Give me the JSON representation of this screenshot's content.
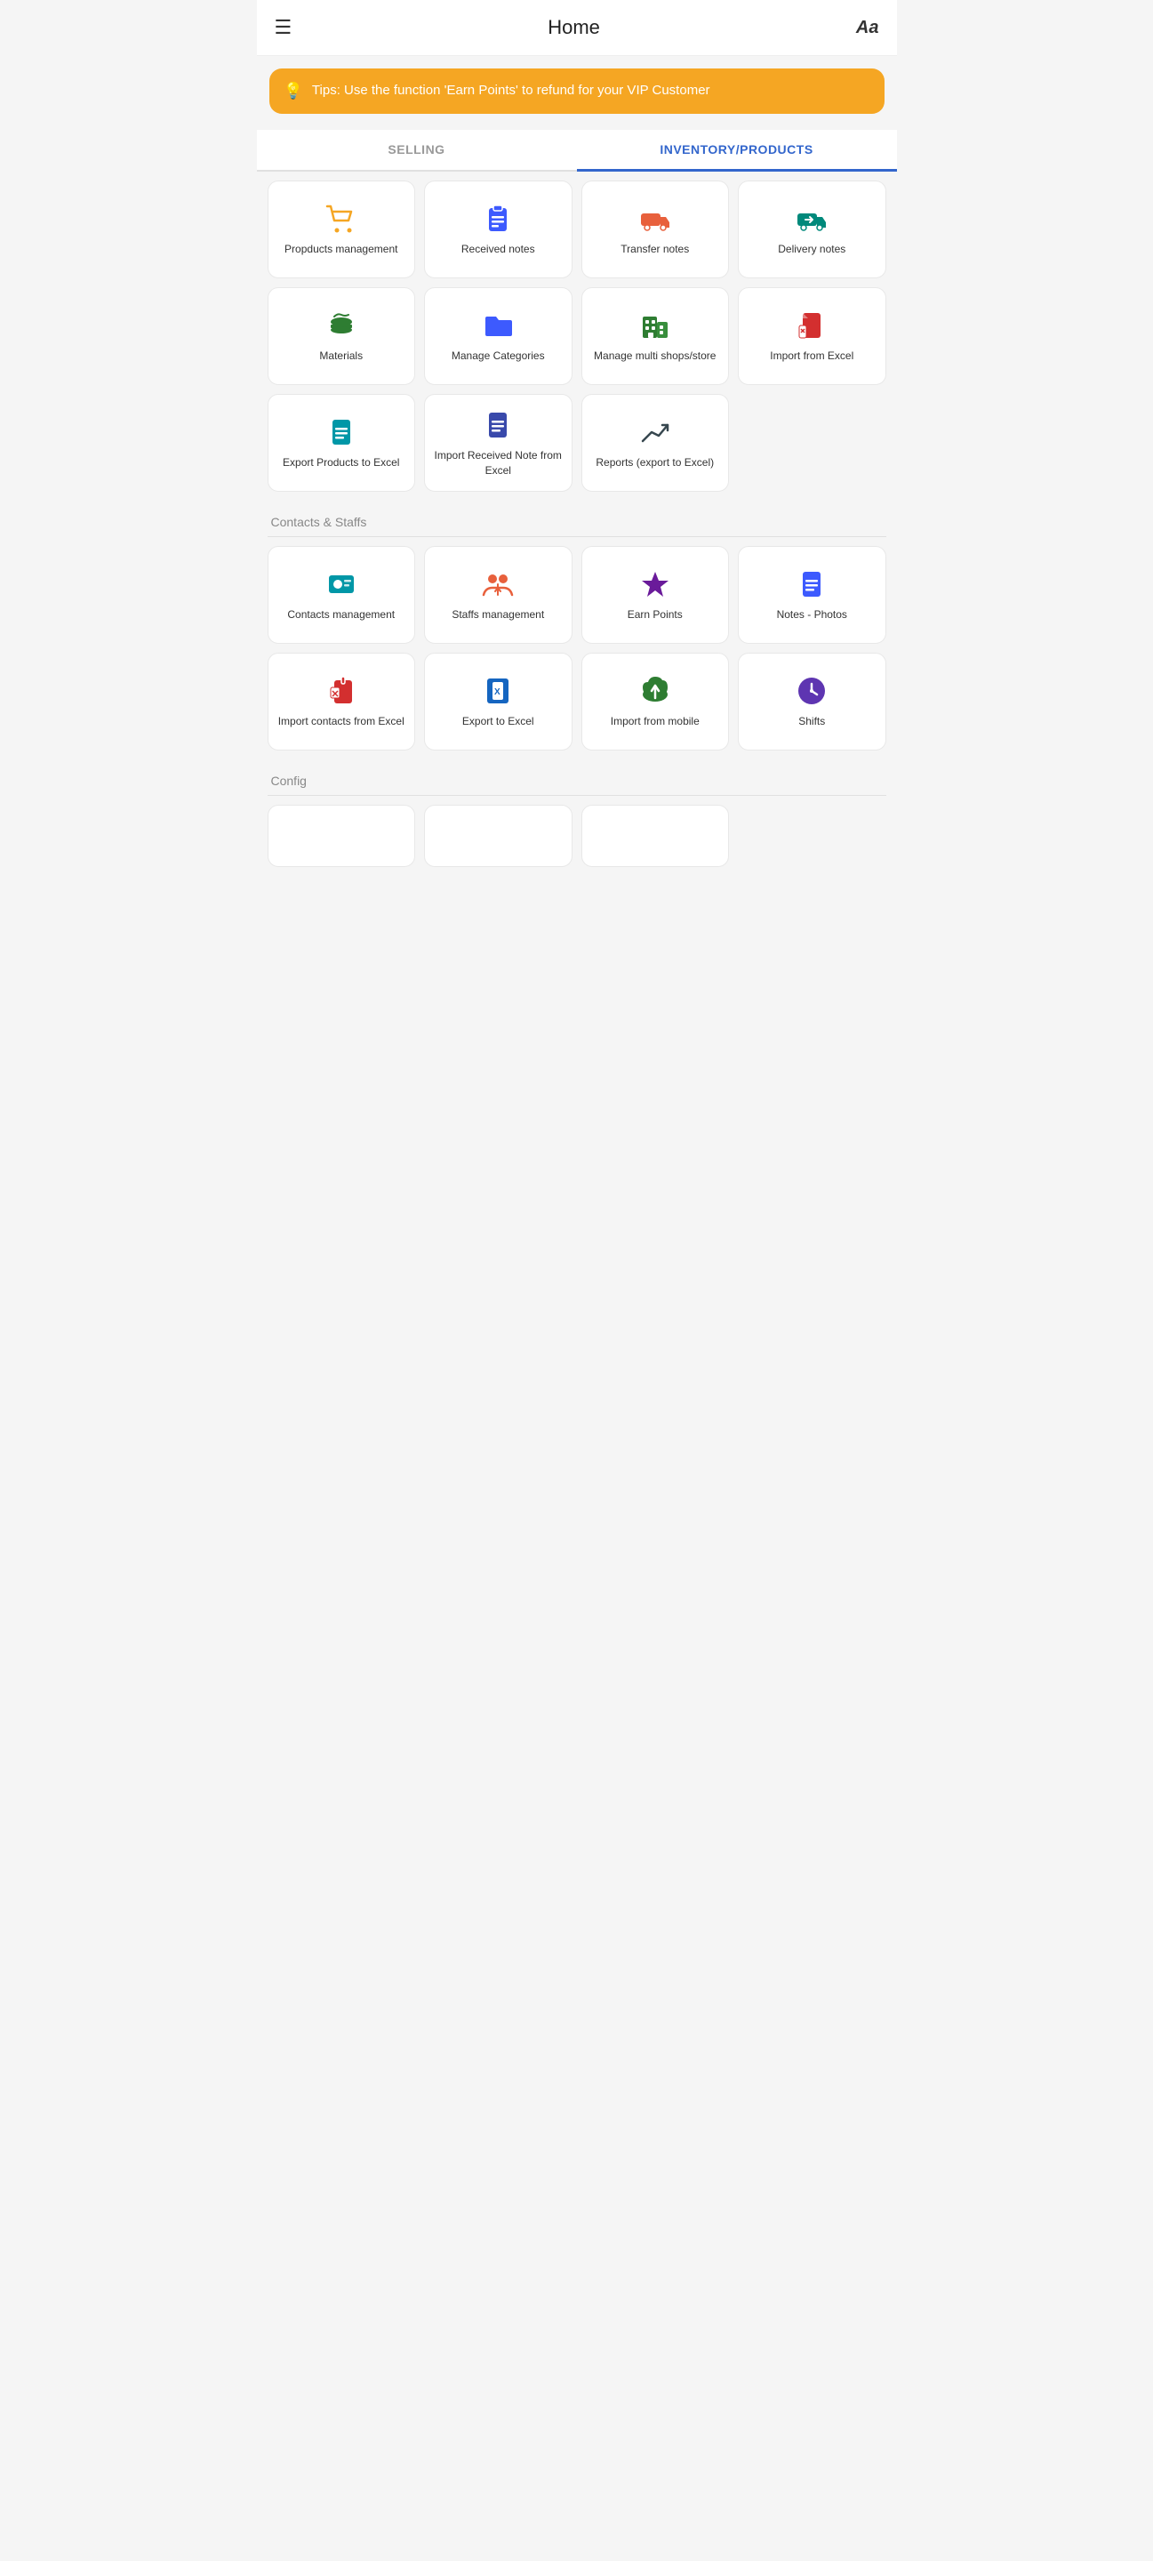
{
  "header": {
    "menu_icon": "☰",
    "title": "Home",
    "font_label": "Aa"
  },
  "tip": {
    "icon": "💡",
    "text": "Tips: Use the function 'Earn Points' to refund for your VIP Customer"
  },
  "tabs": [
    {
      "id": "selling",
      "label": "SELLING",
      "active": false
    },
    {
      "id": "inventory",
      "label": "INVENTORY/PRODUCTS",
      "active": true
    }
  ],
  "inventory_grid": [
    {
      "id": "products-management",
      "label": "Propducts management",
      "icon_type": "cart",
      "color": "yellow"
    },
    {
      "id": "received-notes",
      "label": "Received notes",
      "icon_type": "clipboard",
      "color": "blue"
    },
    {
      "id": "transfer-notes",
      "label": "Transfer notes",
      "icon_type": "truck-right",
      "color": "orange"
    },
    {
      "id": "delivery-notes",
      "label": "Delivery notes",
      "icon_type": "truck-arrow",
      "color": "teal"
    },
    {
      "id": "materials",
      "label": "Materials",
      "icon_type": "burger",
      "color": "green"
    },
    {
      "id": "manage-categories",
      "label": "Manage Categories",
      "icon_type": "folder",
      "color": "blue"
    },
    {
      "id": "manage-multi-shops",
      "label": "Manage multi shops/store",
      "icon_type": "building",
      "color": "green"
    },
    {
      "id": "import-from-excel",
      "label": "Import from Excel",
      "icon_type": "doc-red",
      "color": "red"
    },
    {
      "id": "export-products-excel",
      "label": "Export Products to Excel",
      "icon_type": "doc-lines-cyan",
      "color": "cyan"
    },
    {
      "id": "import-received-note-excel",
      "label": "Import Received Note from Excel",
      "icon_type": "doc-lines-indigo",
      "color": "indigo"
    },
    {
      "id": "reports-export",
      "label": "Reports (export to Excel)",
      "icon_type": "trend-up",
      "color": "dark"
    }
  ],
  "contacts_section": {
    "label": "Contacts & Staffs",
    "grid": [
      {
        "id": "contacts-management",
        "label": "Contacts management",
        "icon_type": "contact-card",
        "color": "cyan"
      },
      {
        "id": "staffs-management",
        "label": "Staffs management",
        "icon_type": "people",
        "color": "orange"
      },
      {
        "id": "earn-points",
        "label": "Earn Points",
        "icon_type": "star",
        "color": "purple"
      },
      {
        "id": "notes-photos",
        "label": "Notes - Photos",
        "icon_type": "doc-blue",
        "color": "blue"
      },
      {
        "id": "import-contacts-excel",
        "label": "Import contacts from Excel",
        "icon_type": "doc-red-clip",
        "color": "red"
      },
      {
        "id": "export-to-excel",
        "label": "Export to Excel",
        "icon_type": "doc-excel",
        "color": "blue"
      },
      {
        "id": "import-from-mobile",
        "label": "Import from mobile",
        "icon_type": "cloud-up",
        "color": "green"
      },
      {
        "id": "shifts",
        "label": "Shifts",
        "icon_type": "clock-circle",
        "color": "violet"
      }
    ]
  },
  "config_section": {
    "label": "Config"
  }
}
